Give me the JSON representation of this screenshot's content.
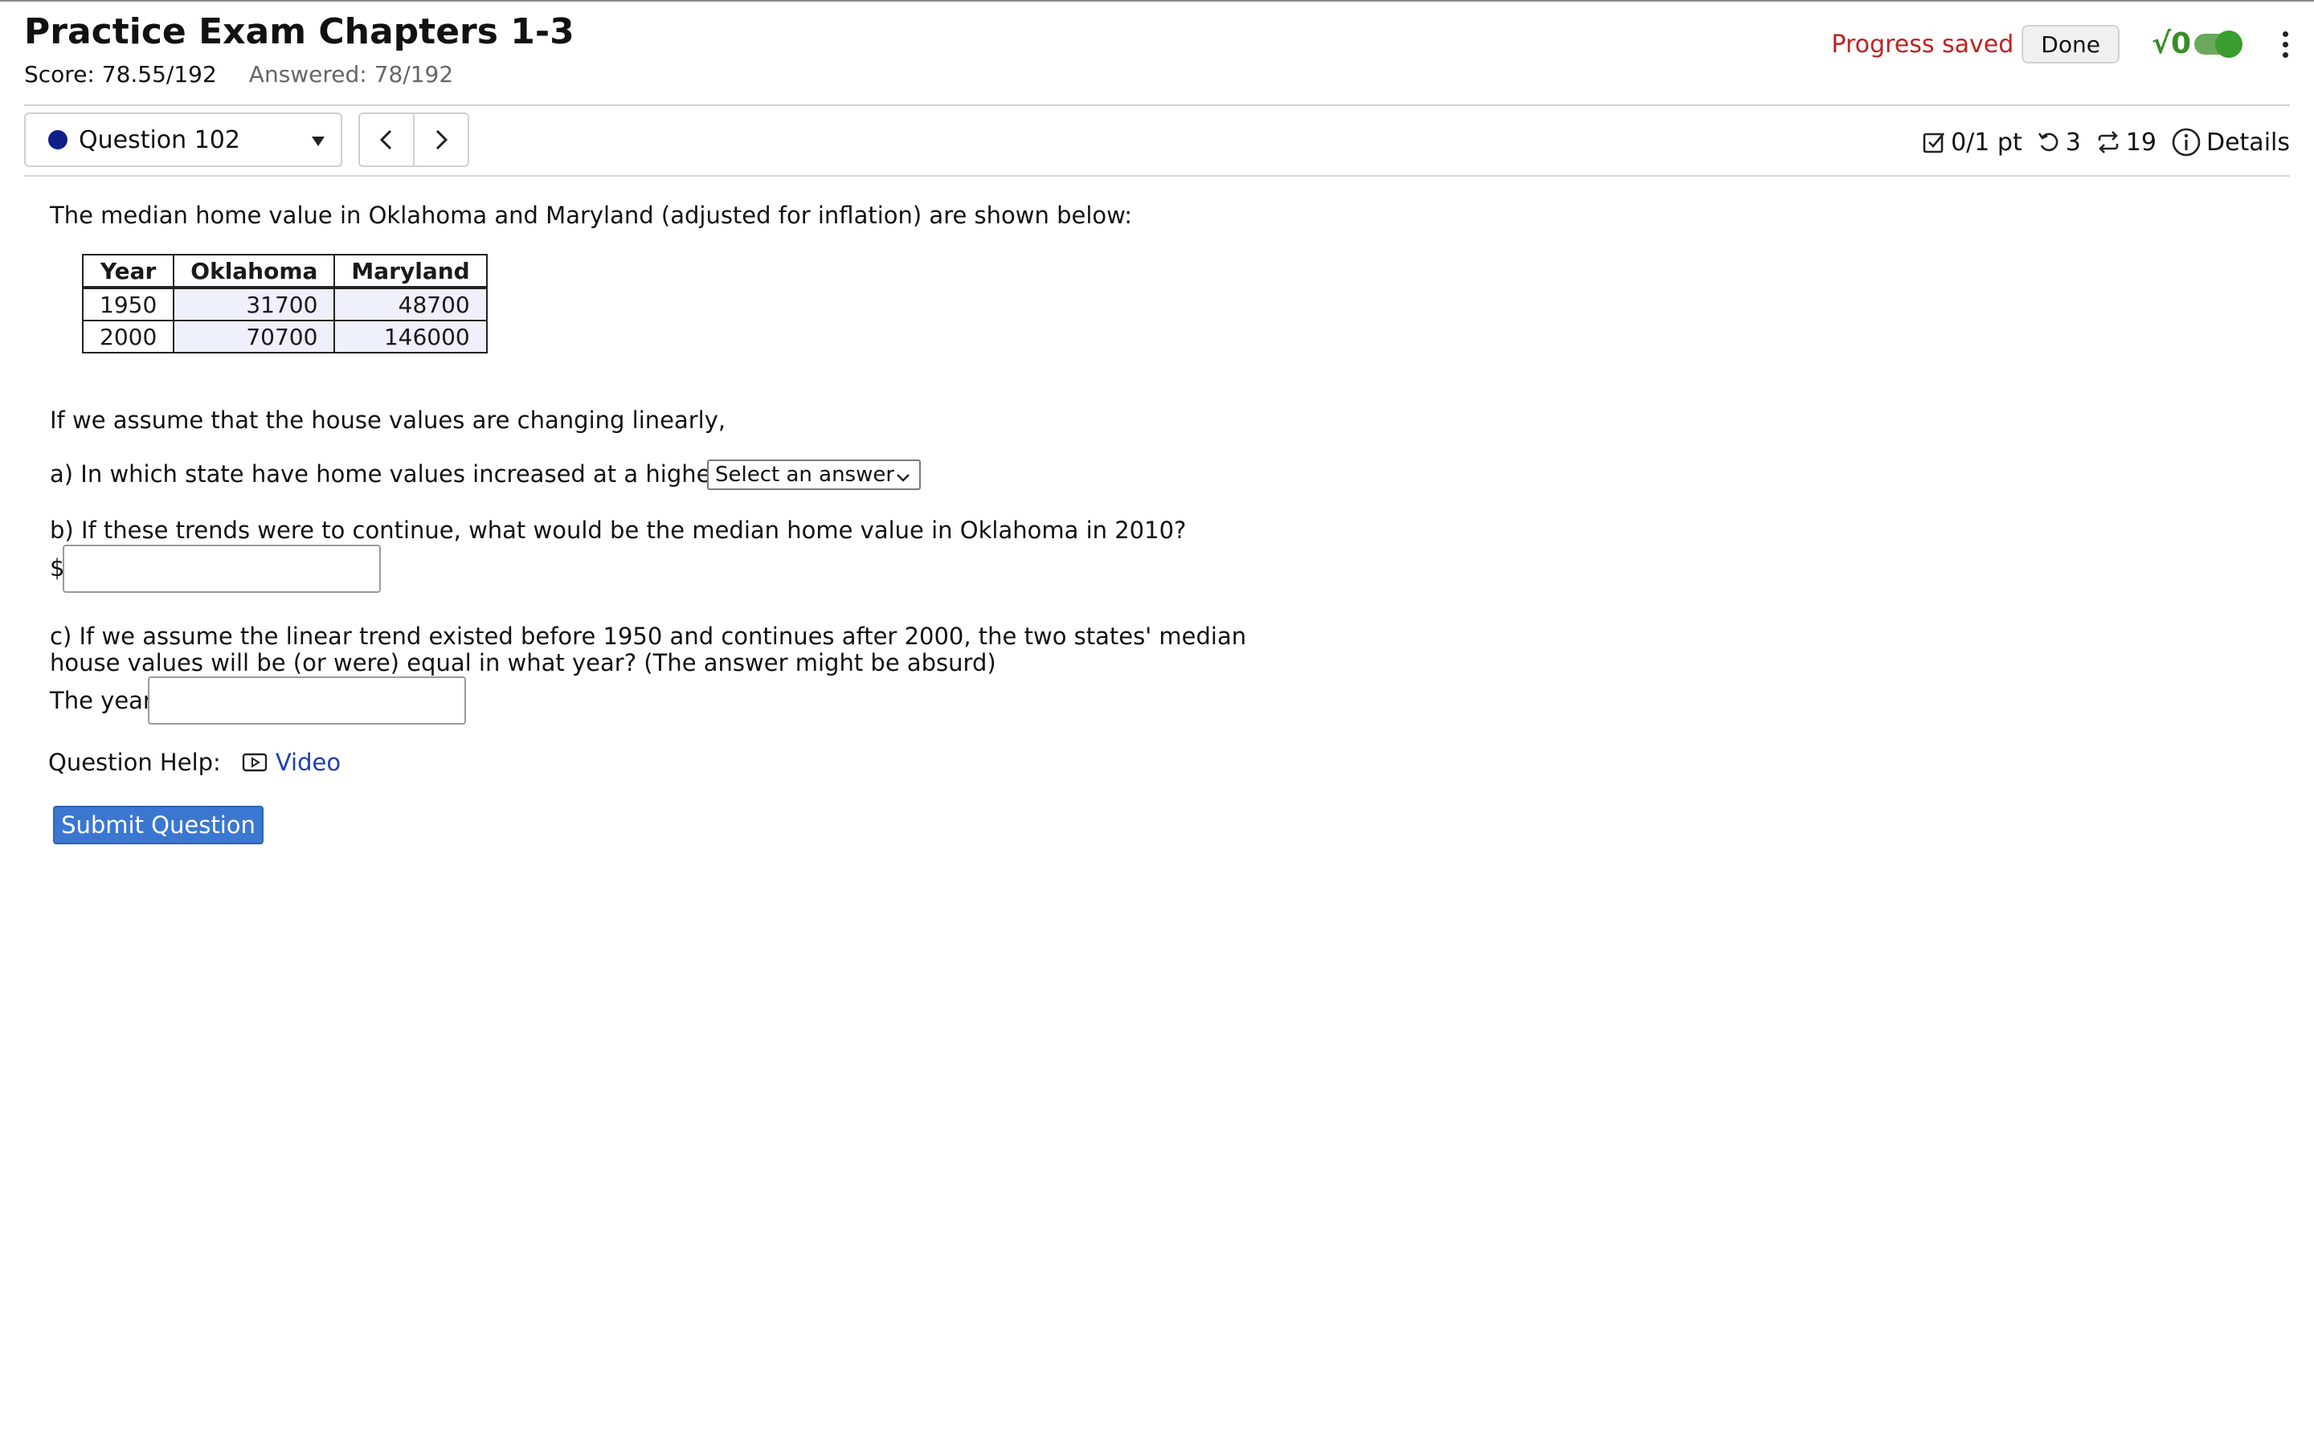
{
  "header": {
    "title": "Practice Exam Chapters 1-3",
    "score": "Score: 78.55/192",
    "answered": "Answered: 78/192",
    "progress_status": "Progress saved",
    "done_label": "Done",
    "math_toggle_label": "√0",
    "math_toggle_on": true
  },
  "question_nav": {
    "selected_question": "Question 102",
    "prev_label": "‹",
    "next_label": "›"
  },
  "question_meta": {
    "points": "0/1 pt",
    "attempts_remaining": "3",
    "versions": "19",
    "details_label": "Details"
  },
  "question": {
    "intro": "The median home value in Oklahoma and Maryland (adjusted for inflation) are shown below:",
    "table": {
      "headers": [
        "Year",
        "Oklahoma",
        "Maryland"
      ],
      "rows": [
        [
          "1950",
          "31700",
          "48700"
        ],
        [
          "2000",
          "70700",
          "146000"
        ]
      ]
    },
    "assumption": "If we assume that the house values are changing linearly,",
    "part_a": "a) In which state have home values increased at a higher rate?",
    "part_a_select_value": "Select an answer",
    "part_b": "b) If these trends were to continue, what would be the median home value in Oklahoma in 2010?",
    "part_b_prefix": "$",
    "part_b_value": "",
    "part_c_line1": "c) If we assume the linear trend existed before 1950 and continues after 2000, the two states' median",
    "part_c_line2": "house values will be (or were) equal in what year? (The answer might be absurd)",
    "part_c_label": "The year",
    "part_c_value": "",
    "help_label": "Question Help:",
    "video_label": "Video",
    "submit_label": "Submit Question"
  },
  "colors": {
    "progress_saved": "#c0211f",
    "status_dot": "#0e1f8a",
    "link": "#1b3fb5",
    "submit_bg": "#3b77d1",
    "toggle": "#3a9d2f"
  }
}
